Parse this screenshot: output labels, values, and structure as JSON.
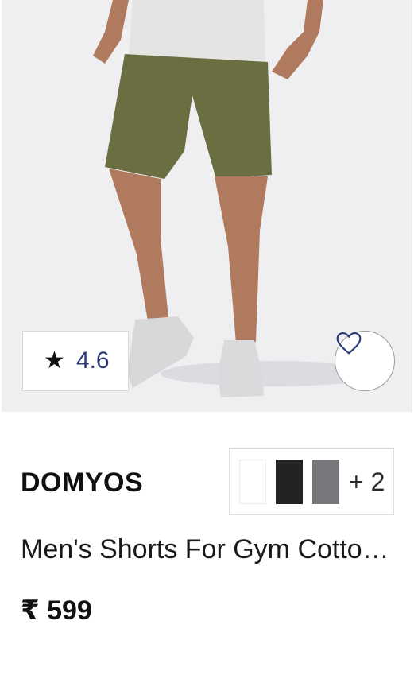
{
  "product": {
    "rating": "4.6",
    "brand": "DOMYOS",
    "title": "Men's Shorts For Gym Cotto…",
    "price": "₹ 599",
    "more_colors": "+ 2",
    "swatches": [
      "#ffffff",
      "#232323",
      "#76787c"
    ]
  },
  "icons": {
    "rating": "star-icon",
    "wishlist": "heart-icon"
  },
  "colors": {
    "rating_text": "#2c3a7a",
    "shorts": "#6b6e40",
    "background": "#efeff1"
  }
}
